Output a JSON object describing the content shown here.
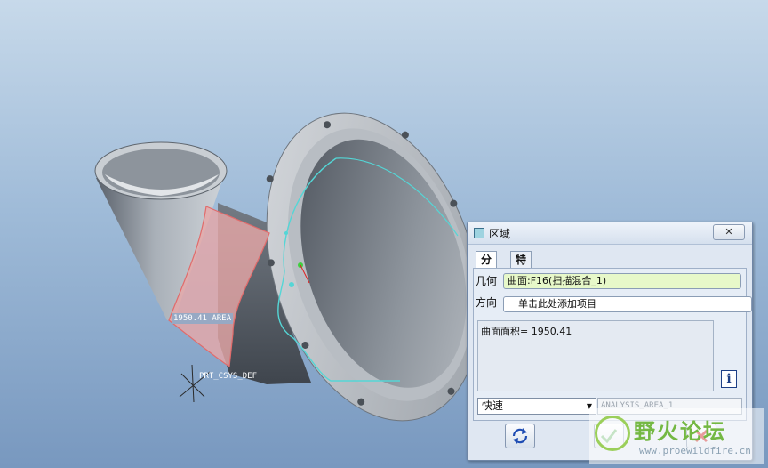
{
  "viewport": {
    "area_annotation": "1950.41 AREA",
    "csys_label": "PRT_CSYS_DEF"
  },
  "dialog": {
    "title": "区域",
    "close_label": "✕",
    "tabs": [
      {
        "label": "分析",
        "active": true
      },
      {
        "label": "特征",
        "active": false
      }
    ],
    "geometry_label": "几何",
    "geometry_value": "曲面:F16(扫描混合_1)",
    "direction_label": "方向",
    "direction_value": "单击此处添加项目",
    "result_text": "曲面面积= 1950.41",
    "info_icon": "i",
    "mode_select": "快速",
    "analysis_name": "ANALYSIS_AREA_1",
    "repeat_icon": "refresh-icon",
    "ok_icon": "check-icon",
    "cancel_icon": "cancel-x-icon"
  },
  "watermark": {
    "text": "野火论坛",
    "url": "www.proewildfire.cn"
  },
  "colors": {
    "background_top": "#c7d9ea",
    "background_bottom": "#7898bf",
    "selection_red": "#e16b6b",
    "edge_cyan": "#54d6d6",
    "field_green": "#e7f8c9"
  }
}
